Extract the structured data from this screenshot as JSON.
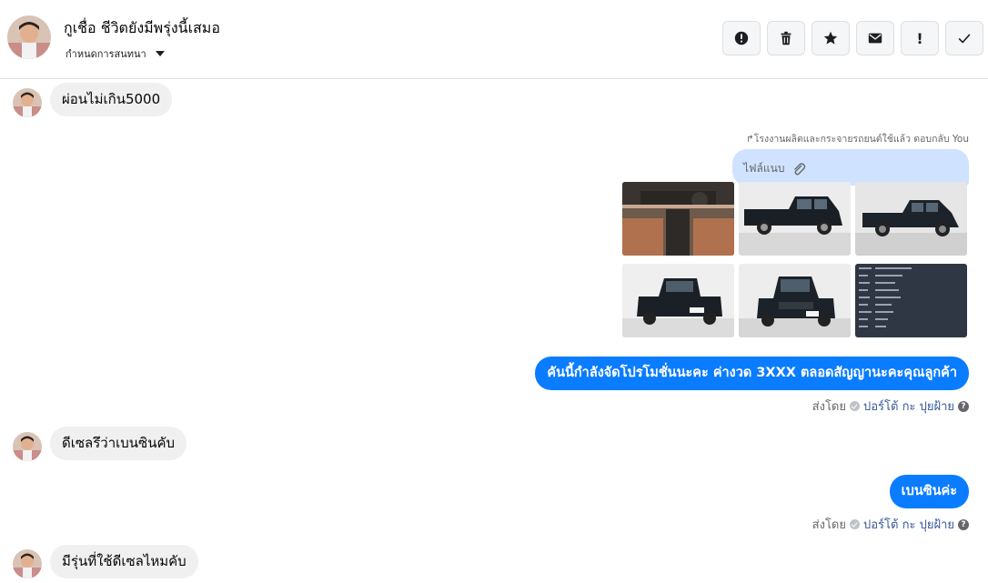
{
  "header": {
    "name": "กูเชื่อ ชีวิตยังมีพรุ่งนี้เสมอ",
    "subtitle": "กำหนดการสนทนา"
  },
  "toolbar": {
    "icons": [
      "alert-circle-icon",
      "trash-icon",
      "star-icon",
      "mail-icon",
      "exclamation-icon",
      "check-icon"
    ],
    "exclamation_label": "!"
  },
  "messages": {
    "m1": "ผ่อนไม่เกิน5000",
    "reply_note": "↱โรงงานผลิตและกระจายรถยนต์ใช้แล้ว ตอบกลับ You",
    "attachment_label": "ไฟล์แนบ",
    "m2": "คันนี้กำลังจัดโปรโมชั่นนะคะ ค่างวด 3XXX ตลอดสัญญานะคะคุณลูกค้า",
    "sent_prefix": "ส่งโดย",
    "sent_name": "ปอร์โต้ กะ ปุยฝ้าย",
    "m3": "ดีเซลรึว่าเบนซินคับ",
    "m4": "เบนซินค่ะ",
    "m5": "มีรุ่นที่ใช้ดีเซลไหมคับ"
  },
  "colors": {
    "outgoing": "#0a7cff",
    "incoming": "#f0f0f0",
    "attachment": "#cfe2ff"
  }
}
